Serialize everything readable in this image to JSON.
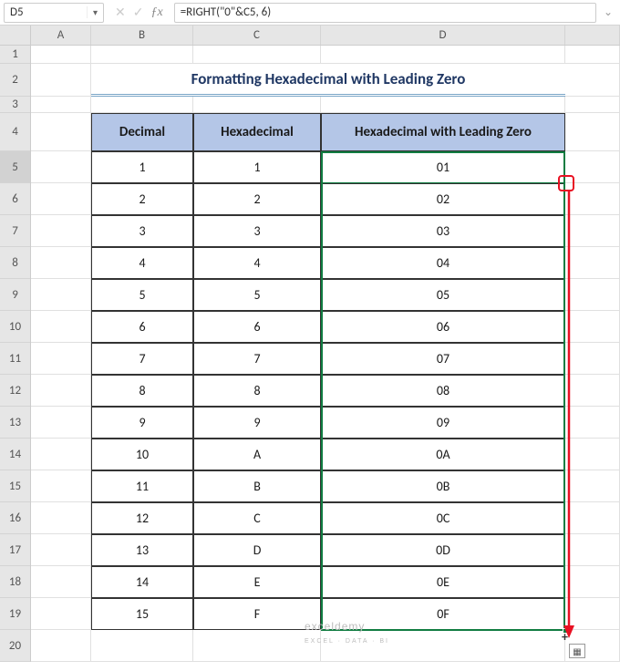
{
  "namebox": {
    "value": "D5"
  },
  "formula_bar": {
    "value": "=RIGHT(\"0\"&C5, 6)"
  },
  "columns": [
    "A",
    "B",
    "C",
    "D"
  ],
  "row_headers": [
    "1",
    "2",
    "3",
    "4",
    "5",
    "6",
    "7",
    "8",
    "9",
    "10",
    "11",
    "12",
    "13",
    "14",
    "15",
    "16",
    "17",
    "18",
    "19",
    "20"
  ],
  "title": "Formatting Hexadecimal with Leading Zero",
  "table_headers": {
    "b": "Decimal",
    "c": "Hexadecimal",
    "d": "Hexadecimal with Leading Zero"
  },
  "rows": [
    {
      "dec": "1",
      "hex": "1",
      "lz": "01"
    },
    {
      "dec": "2",
      "hex": "2",
      "lz": "02"
    },
    {
      "dec": "3",
      "hex": "3",
      "lz": "03"
    },
    {
      "dec": "4",
      "hex": "4",
      "lz": "04"
    },
    {
      "dec": "5",
      "hex": "5",
      "lz": "05"
    },
    {
      "dec": "6",
      "hex": "6",
      "lz": "06"
    },
    {
      "dec": "7",
      "hex": "7",
      "lz": "07"
    },
    {
      "dec": "8",
      "hex": "8",
      "lz": "08"
    },
    {
      "dec": "9",
      "hex": "9",
      "lz": "09"
    },
    {
      "dec": "10",
      "hex": "A",
      "lz": "0A"
    },
    {
      "dec": "11",
      "hex": "B",
      "lz": "0B"
    },
    {
      "dec": "12",
      "hex": "C",
      "lz": "0C"
    },
    {
      "dec": "13",
      "hex": "D",
      "lz": "0D"
    },
    {
      "dec": "14",
      "hex": "E",
      "lz": "0E"
    },
    {
      "dec": "15",
      "hex": "F",
      "lz": "0F"
    }
  ],
  "watermark": "exceldemy",
  "watermark_sub": "EXCEL · DATA · BI",
  "selected_row": "5"
}
